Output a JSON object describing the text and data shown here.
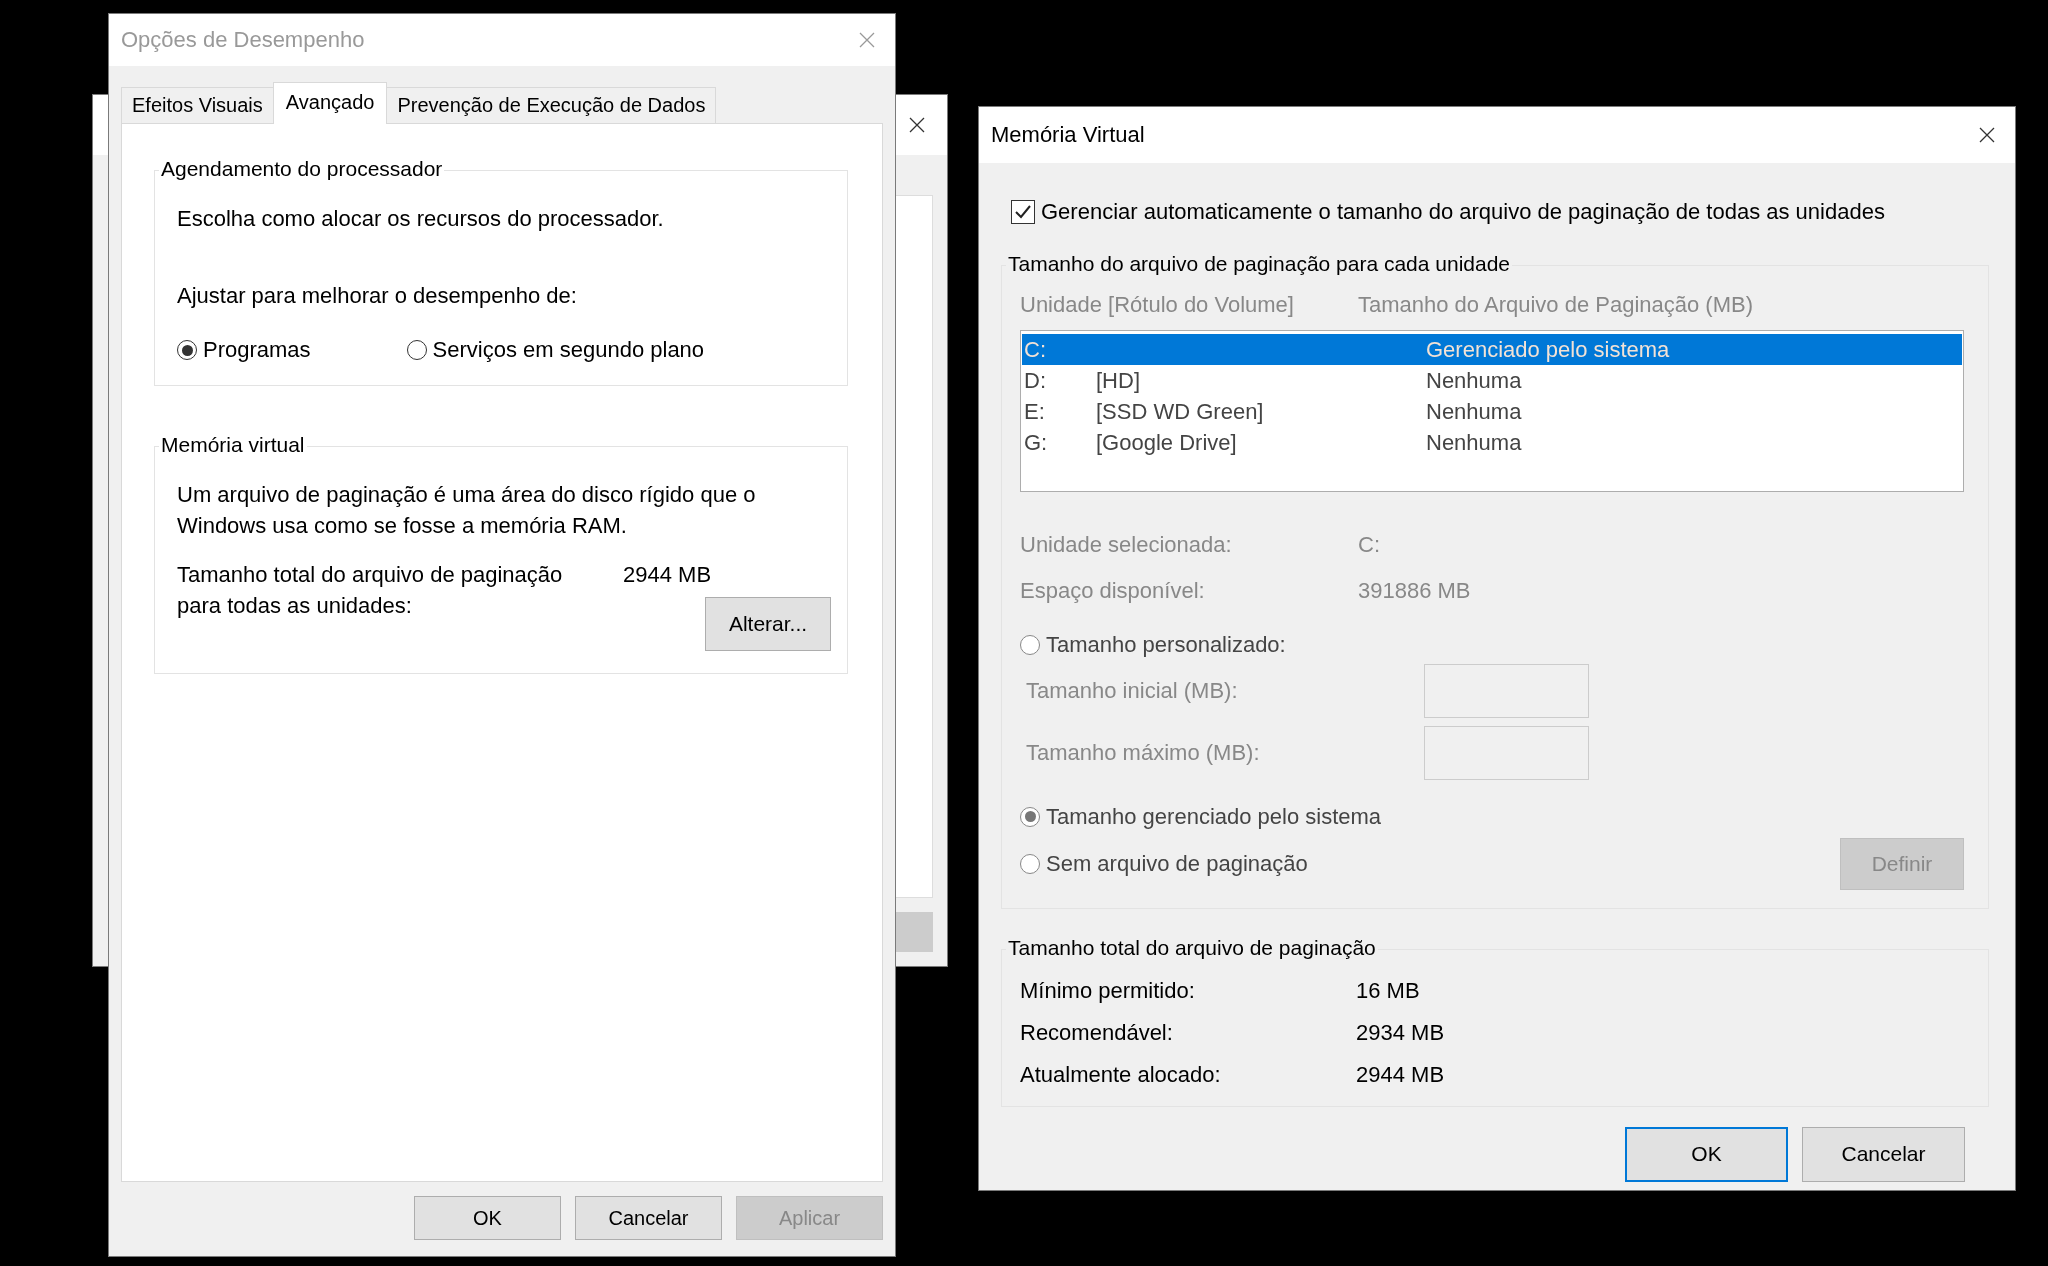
{
  "performance_dialog": {
    "title": "Opções de Desempenho",
    "tabs": [
      {
        "label": "Efeitos Visuais",
        "selected": false
      },
      {
        "label": "Avançado",
        "selected": true
      },
      {
        "label": "Prevenção de Execução de Dados",
        "selected": false
      }
    ],
    "processor_group": {
      "title": "Agendamento do processador",
      "description": "Escolha como alocar os recursos do processador.",
      "adjust_label": "Ajustar para melhorar o desempenho de:",
      "options": [
        {
          "label": "Programas",
          "selected": true
        },
        {
          "label": "Serviços em segundo plano",
          "selected": false
        }
      ]
    },
    "virtual_memory_group": {
      "title": "Memória virtual",
      "description": "Um arquivo de paginação é uma área do disco rígido que o Windows usa como se fosse a memória RAM.",
      "total_label": "Tamanho total do arquivo de paginação para todas as unidades:",
      "total_value": "2944 MB",
      "change_button": "Alterar..."
    },
    "buttons": [
      {
        "label": "OK",
        "disabled": false
      },
      {
        "label": "Cancelar",
        "disabled": false
      },
      {
        "label": "Aplicar",
        "disabled": true
      }
    ]
  },
  "virtual_memory_dialog": {
    "title": "Memória Virtual",
    "auto_manage": {
      "label": "Gerenciar automaticamente o tamanho do arquivo de paginação de todas as unidades",
      "checked": true
    },
    "drive_group": {
      "title": "Tamanho do arquivo de paginação para cada unidade",
      "disabled": true,
      "columns": [
        "Unidade [Rótulo do Volume]",
        "Tamanho do Arquivo de Paginação (MB)"
      ],
      "drives": [
        {
          "letter": "C:",
          "size": "Gerenciado pelo sistema",
          "selected": true
        },
        {
          "letter": "D:",
          "label": "[HD]",
          "size": "Nenhuma",
          "selected": false
        },
        {
          "letter": "E:",
          "label": "[SSD WD Green]",
          "size": "Nenhuma",
          "selected": false
        },
        {
          "letter": "G:",
          "label": "[Google Drive]",
          "size": "Nenhuma",
          "selected": false
        }
      ],
      "info": [
        {
          "label": "Unidade selecionada:",
          "value": "C:"
        },
        {
          "label": "Espaço disponível:",
          "value": "391886 MB"
        }
      ],
      "custom_option": {
        "label": "Tamanho personalizado:",
        "selected": false
      },
      "fields": [
        {
          "label": "Tamanho inicial (MB):"
        },
        {
          "label": "Tamanho máximo (MB):"
        }
      ],
      "other_options": [
        {
          "label": "Tamanho gerenciado pelo sistema",
          "selected": true
        },
        {
          "label": "Sem arquivo de paginação",
          "selected": false
        }
      ],
      "set_button": {
        "label": "Definir",
        "disabled": true
      }
    },
    "totals_group": {
      "title": "Tamanho total do arquivo de paginação",
      "rows": [
        {
          "label": "Mínimo permitido:",
          "value": "16 MB"
        },
        {
          "label": "Recomendável:",
          "value": "2934 MB"
        },
        {
          "label": "Atualmente alocado:",
          "value": "2944 MB"
        }
      ]
    },
    "buttons": [
      {
        "label": "OK",
        "default": true
      },
      {
        "label": "Cancelar",
        "default": false
      }
    ]
  }
}
